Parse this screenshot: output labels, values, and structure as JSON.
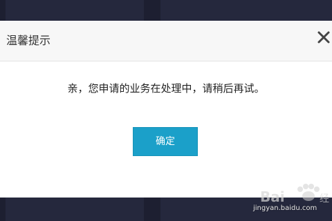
{
  "dialog": {
    "title": "温馨提示",
    "message": "亲，您申请的业务在处理中，请稍后再试。",
    "confirm_label": "确定",
    "close_icon": "close-icon"
  },
  "watermark": {
    "logo_text": "Baidu经验",
    "url": "jingyan.baidu.com"
  },
  "colors": {
    "backdrop": "#1d1f31",
    "header_bg": "#f7f7f7",
    "confirm_bg": "#1ba0c9"
  }
}
